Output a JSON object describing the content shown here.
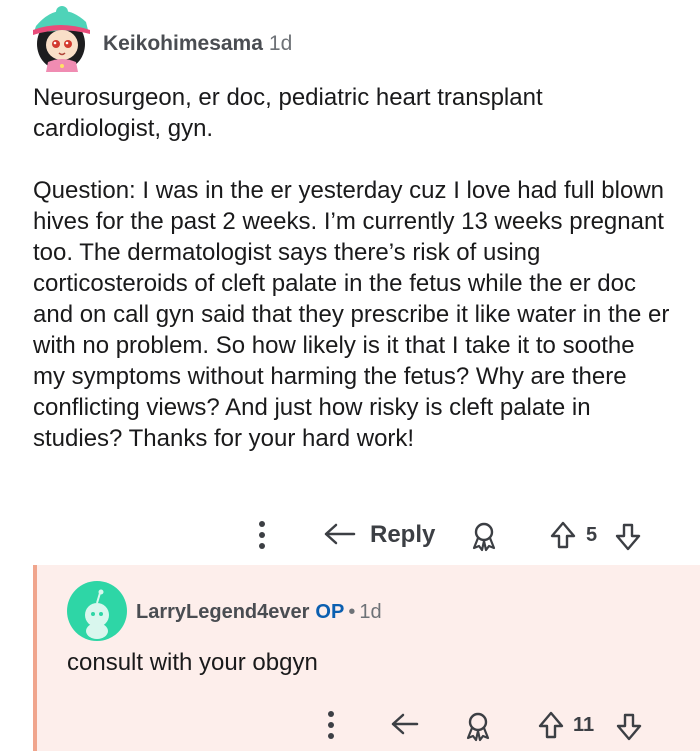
{
  "comment": {
    "author": "Keikohimesama",
    "age": "1d",
    "paragraphs": [
      "Neurosurgeon, er doc, pediatric heart transplant cardiologist, gyn.",
      "Question: I was in the er yesterday cuz I love had full blown hives for the past 2 weeks. I’m currently 13 weeks pregnant too. The dermatologist says there’s risk of using corticosteroids of cleft palate in the fetus while the er doc and on call gyn said that they prescribe it like water in the er with no problem. So how likely is it that I take it to soothe my symptoms without harming the fetus? Why are there conflicting views? And just how risky is cleft palate in studies? Thanks for your hard work!"
    ],
    "actions": {
      "reply_label": "Reply",
      "vote_count": "5"
    }
  },
  "reply": {
    "author": "LarryLegend4ever",
    "op_badge": "OP",
    "separator": "•",
    "age": "1d",
    "body": "consult with your obgyn",
    "actions": {
      "vote_count": "11"
    }
  },
  "colors": {
    "reply_background": "#fdeeeb",
    "reply_thread_line": "#f0a58d",
    "op_blue": "#0b5fb0",
    "snoo_avatar_bg": "#2ed6a6"
  }
}
